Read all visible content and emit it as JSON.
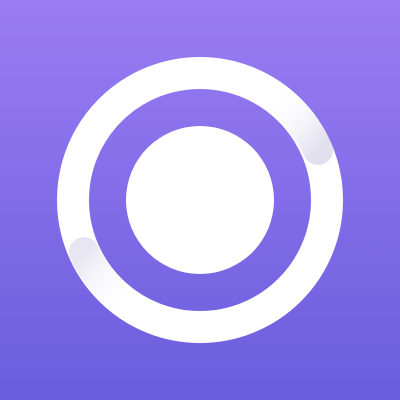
{
  "app_icon": {
    "icon_name": "ring-and-dot-logo-icon",
    "colors": {
      "background_top": "#9a7cf3",
      "background_bottom": "#6a5ddc",
      "mark": "#ffffff",
      "fold_shadow": "#c9c6e0"
    }
  }
}
